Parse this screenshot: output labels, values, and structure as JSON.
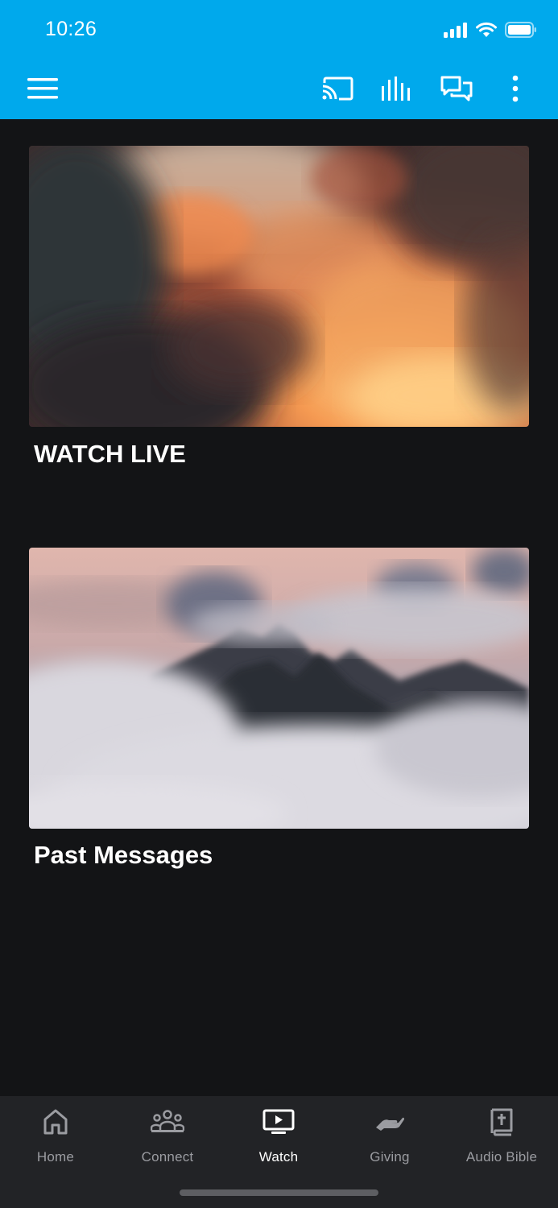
{
  "status": {
    "time": "10:26"
  },
  "header": {
    "icons": [
      "menu-icon",
      "cast-icon",
      "audio-levels-icon",
      "chat-icon",
      "more-vertical-icon"
    ],
    "background": "#00a9ec"
  },
  "cards": [
    {
      "title": "WATCH LIVE",
      "image": "sunset-clouds"
    },
    {
      "title": "Past Messages",
      "image": "mountains-above-clouds"
    }
  ],
  "tabs": [
    {
      "label": "Home",
      "icon": "home-icon",
      "active": false
    },
    {
      "label": "Connect",
      "icon": "people-icon",
      "active": false
    },
    {
      "label": "Watch",
      "icon": "tv-play-icon",
      "active": true
    },
    {
      "label": "Giving",
      "icon": "giving-hand-icon",
      "active": false
    },
    {
      "label": "Audio Bible",
      "icon": "bible-icon",
      "active": false
    }
  ]
}
